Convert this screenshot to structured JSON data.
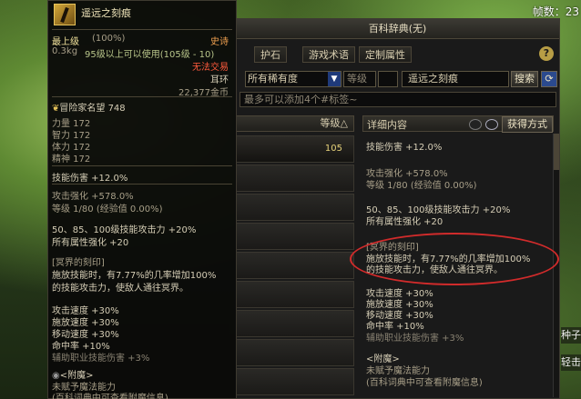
{
  "hud": {
    "fatigue": "帧数：23"
  },
  "window": {
    "title": "百科辞典(无)",
    "tabs": [
      "护石",
      "游戏术语",
      "定制属性"
    ],
    "help": "?",
    "rarity_select": "所有稀有度",
    "level_label": "等级",
    "search_value": "遥远之刻痕",
    "search_button": "搜索",
    "refresh_icon": "refresh-icon",
    "tags_placeholder": "最多可以添加4个#标签~",
    "list_header": "等级△",
    "list_rows": [
      {
        "level": "105"
      },
      {
        "level": ""
      },
      {
        "level": ""
      },
      {
        "level": ""
      },
      {
        "level": ""
      },
      {
        "level": ""
      },
      {
        "level": ""
      },
      {
        "level": ""
      },
      {
        "level": ""
      }
    ],
    "detail_header": "详细内容",
    "obtain_button": "获得方式",
    "detail": {
      "skill_damage": "技能伤害 +12.0%",
      "atk_boost": "攻击强化 +578.0%",
      "level_exp": "等级 1/80 (经验值 0.00%)",
      "skill_atk": "50、85、100级技能攻击力 +20%",
      "all_attr": "所有属性强化 +20",
      "mark_title": "[冥界的刻印]",
      "mark_line1": "施放技能时，有7.77%的几率增加100%",
      "mark_line2": "的技能攻击力，使敌人通往冥界。",
      "atk_speed": "攻击速度 +30%",
      "cast_speed": "施放速度 +30%",
      "move_speed": "移动速度 +30%",
      "hit_rate": "命中率 +10%",
      "aux_skill": "辅助职业技能伤害 +3%",
      "enchant_title": "<附魔>",
      "enchant_desc": "未赋予魔法能力",
      "enchant_note": "(百科词典中可查看附魔信息)"
    }
  },
  "tooltip": {
    "name": "遥远之刻痕",
    "grade": "最上级",
    "grade_pct": "(100%)",
    "rarity": "史诗",
    "weight": "0.3kg",
    "req": "95级以上可以使用(105级 - 10)",
    "untradeable": "无法交易",
    "slot": "耳环",
    "price": "22,377金币",
    "reputation": "冒险家名望 748",
    "str": "力量  172",
    "int": "智力  172",
    "vit": "体力  172",
    "spi": "精神  172",
    "skill_damage": "技能伤害 +12.0%",
    "atk_boost": "攻击强化 +578.0%",
    "level_exp": "等级 1/80 (经验值 0.00%)",
    "skill_atk": "50、85、100级技能攻击力 +20%",
    "all_attr": "所有属性强化 +20",
    "mark_title": "[冥界的刻印]",
    "mark_line1": "施放技能时，有7.77%的几率增加100%",
    "mark_line2": "的技能攻击力，使敌人通往冥界。",
    "atk_speed": "攻击速度 +30%",
    "cast_speed": "施放速度 +30%",
    "move_speed": "移动速度 +30%",
    "hit_rate": "命中率 +10%",
    "aux_skill": "辅助职业技能伤害 +3%",
    "enchant_title": "<附魔>",
    "enchant_desc": "未赋予魔法能力",
    "enchant_note": "(百科词典中可查看附魔信息)"
  },
  "side_text": {
    "right1": "种子",
    "right2": "轻击"
  }
}
